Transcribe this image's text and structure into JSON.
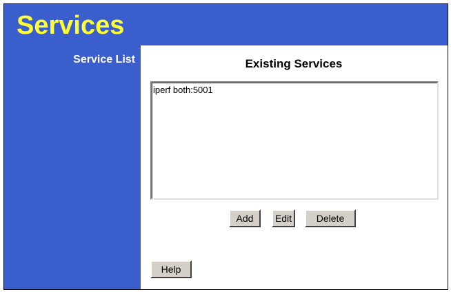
{
  "header": {
    "title": "Services"
  },
  "sidebar": {
    "label": "Service List"
  },
  "main": {
    "section_title": "Existing Services",
    "services": [
      "iperf both:5001"
    ],
    "buttons": {
      "add": "Add",
      "edit": "Edit",
      "delete": "Delete",
      "help": "Help"
    }
  },
  "colors": {
    "header_bg": "#3a5fcd",
    "title_text": "#ffff33",
    "button_face": "#d4d0c8"
  }
}
